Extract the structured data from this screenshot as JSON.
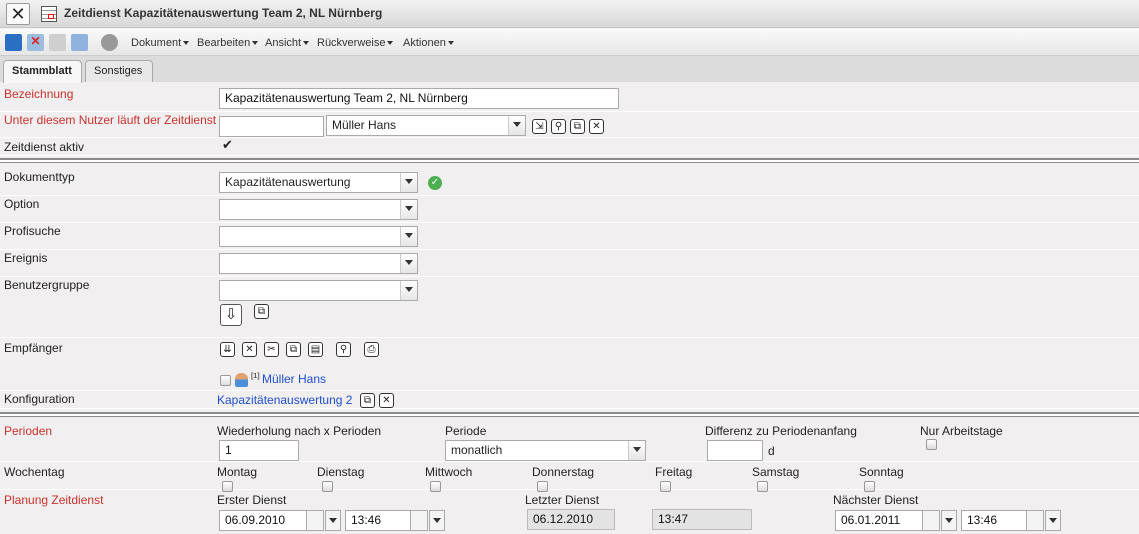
{
  "window": {
    "title": "Zeitdienst Kapazitätenauswertung Team 2, NL Nürnberg"
  },
  "menu": [
    "Dokument",
    "Bearbeiten",
    "Ansicht",
    "Rückverweise",
    "Aktionen"
  ],
  "tabs": [
    "Stammblatt",
    "Sonstiges"
  ],
  "form": {
    "bezeichnung_label": "Bezeichnung",
    "bezeichnung_value": "Kapazitätenauswertung Team 2, NL Nürnberg",
    "nutzer_label": "Unter diesem Nutzer läuft der Zeitdienst",
    "nutzer_value": "Müller Hans",
    "aktiv_label": "Zeitdienst aktiv",
    "dokumenttyp_label": "Dokumenttyp",
    "dokumenttyp_value": "Kapazitätenauswertung",
    "option_label": "Option",
    "profisuche_label": "Profisuche",
    "ereignis_label": "Ereignis",
    "benutzergruppe_label": "Benutzergruppe",
    "empfaenger_label": "Empfänger",
    "empfaenger_index": "[1]",
    "empfaenger_name": "Müller Hans",
    "konfiguration_label": "Konfiguration",
    "konfiguration_value": "Kapazitätenauswertung 2"
  },
  "perioden": {
    "label": "Perioden",
    "wiederholung_label": "Wiederholung nach x Perioden",
    "wiederholung_value": "1",
    "periode_label": "Periode",
    "periode_value": "monatlich",
    "differenz_label": "Differenz zu Periodenanfang",
    "differenz_unit": "d",
    "nur_arbeitstage_label": "Nur Arbeitstage"
  },
  "wochentag": {
    "label": "Wochentag",
    "days": [
      "Montag",
      "Dienstag",
      "Mittwoch",
      "Donnerstag",
      "Freitag",
      "Samstag",
      "Sonntag"
    ]
  },
  "planung": {
    "label": "Planung Zeitdienst",
    "erster_label": "Erster Dienst",
    "erster_date": "06.09.2010",
    "erster_time": "13:46",
    "letzter_label": "Letzter Dienst",
    "letzter_date": "06.12.2010",
    "letzter_time": "13:47",
    "naechster_label": "Nächster Dienst",
    "naechster_date": "06.01.2011",
    "naechster_time": "13:46"
  }
}
